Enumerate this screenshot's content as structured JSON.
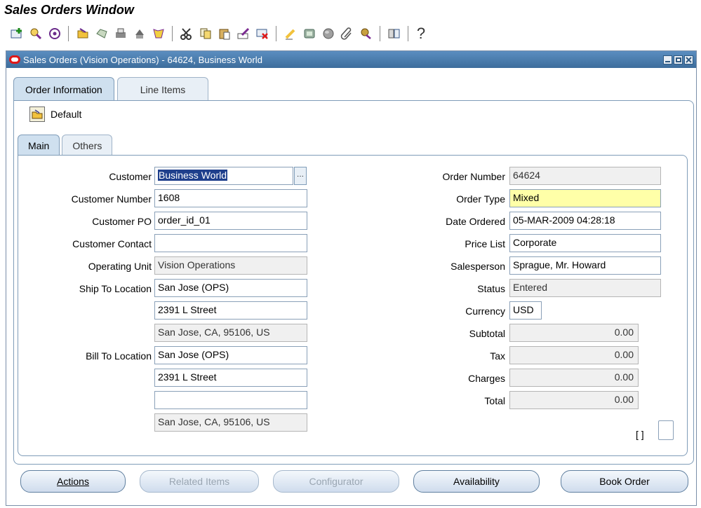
{
  "page_title": "Sales Orders Window",
  "toolbar": {
    "icons": [
      "new-record-icon",
      "find-icon",
      "navigator-icon",
      "open-folder-icon",
      "save-icon",
      "print-icon",
      "attach-icon",
      "zoom-icon",
      "cut-icon",
      "copy-icon",
      "paste-icon",
      "edit-field-icon",
      "delete-record-icon",
      "edit-icon",
      "translations-icon",
      "globe-icon",
      "attachments-icon",
      "folder-tools-icon",
      "window-help-icon",
      "help-icon"
    ],
    "help_glyph": "?"
  },
  "window": {
    "title": "Sales Orders (Vision Operations) - 64624, Business World"
  },
  "tabs": {
    "order_information": "Order Information",
    "line_items": "Line Items"
  },
  "default_label": "Default",
  "subtabs": {
    "main": "Main",
    "others": "Others"
  },
  "left_fields": {
    "customer_label": "Customer",
    "customer_value": "Business World",
    "lov_glyph": "···",
    "customer_number_label": "Customer Number",
    "customer_number_value": "1608",
    "customer_po_label": "Customer PO",
    "customer_po_value": "order_id_01",
    "customer_contact_label": "Customer Contact",
    "customer_contact_value": "",
    "operating_unit_label": "Operating Unit",
    "operating_unit_value": "Vision Operations",
    "ship_to_label": "Ship To Location",
    "ship_to_line1": "San Jose (OPS)",
    "ship_to_line2": "2391 L Street",
    "ship_to_line3": "San Jose, CA, 95106, US",
    "bill_to_label": "Bill To Location",
    "bill_to_line1": "San Jose (OPS)",
    "bill_to_line2": "2391 L Street",
    "bill_to_line3": "",
    "bill_to_line4": "San Jose, CA, 95106, US"
  },
  "right_fields": {
    "order_number_label": "Order Number",
    "order_number_value": "64624",
    "order_type_label": "Order Type",
    "order_type_value": "Mixed",
    "date_ordered_label": "Date Ordered",
    "date_ordered_value": "05-MAR-2009 04:28:18",
    "price_list_label": "Price List",
    "price_list_value": "Corporate",
    "salesperson_label": "Salesperson",
    "salesperson_value": "Sprague, Mr. Howard",
    "status_label": "Status",
    "status_value": "Entered",
    "currency_label": "Currency",
    "currency_value": "USD",
    "subtotal_label": "Subtotal",
    "subtotal_value": "0.00",
    "tax_label": "Tax",
    "tax_value": "0.00",
    "charges_label": "Charges",
    "charges_value": "0.00",
    "total_label": "Total",
    "total_value": "0.00",
    "bracket_text": "[ ]"
  },
  "buttons": {
    "actions": "Actions",
    "related_items": "Related Items",
    "configurator": "Configurator",
    "availability": "Availability",
    "book_order": "Book Order"
  },
  "colors": {
    "required_field": "#ffffa8",
    "titlebar": "#3d6d9c",
    "selection": "#1e3f8c"
  }
}
